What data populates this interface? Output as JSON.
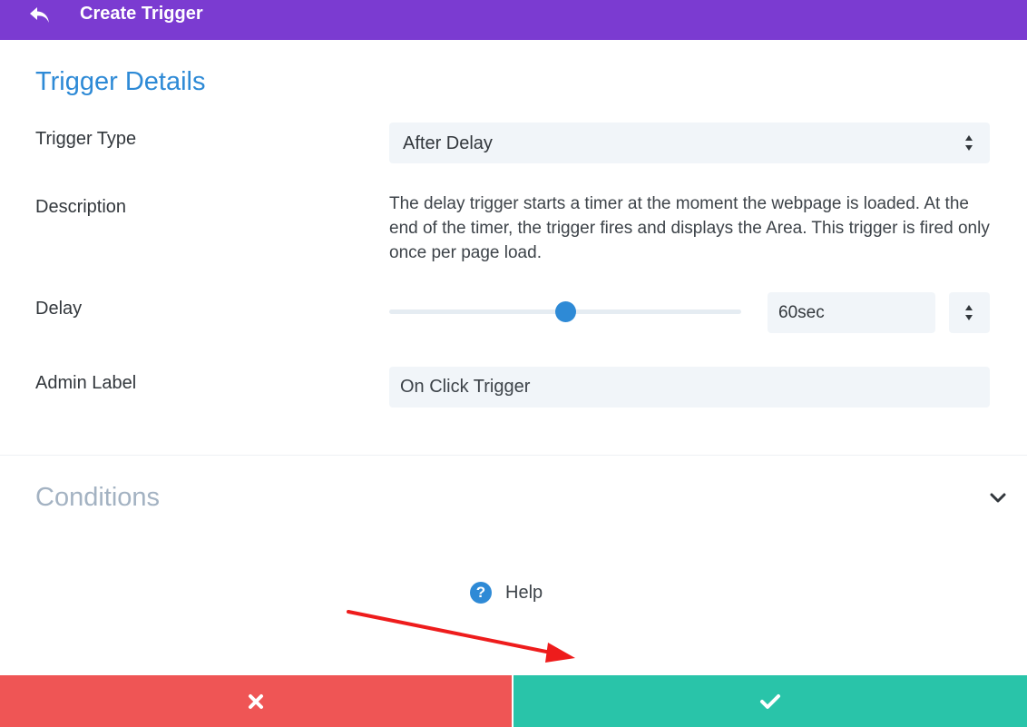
{
  "header": {
    "title": "Create Trigger",
    "back_icon": "undo-arrow-icon",
    "background": "#7b3bd1"
  },
  "details": {
    "section_title": "Trigger Details",
    "trigger_type": {
      "label": "Trigger Type",
      "selected": "After Delay"
    },
    "description": {
      "label": "Description",
      "text": "The delay trigger starts a timer at the moment the webpage is loaded. At the end of the timer, the trigger fires and displays the Area. This trigger is fired only once per page load."
    },
    "delay": {
      "label": "Delay",
      "value": "60sec",
      "slider_fraction": 0.5
    },
    "admin_label": {
      "label": "Admin Label",
      "value": "On Click Trigger"
    }
  },
  "conditions": {
    "title": "Conditions",
    "icon": "chevron-down-icon"
  },
  "help": {
    "label": "Help",
    "icon": "question-icon"
  },
  "footer": {
    "cancel_icon": "close-icon",
    "save_icon": "check-icon",
    "cancel_color": "#ef5555",
    "save_color": "#29c4a9"
  },
  "colors": {
    "accent": "#2e8ad6",
    "annotation_arrow": "#ee1c1c"
  }
}
